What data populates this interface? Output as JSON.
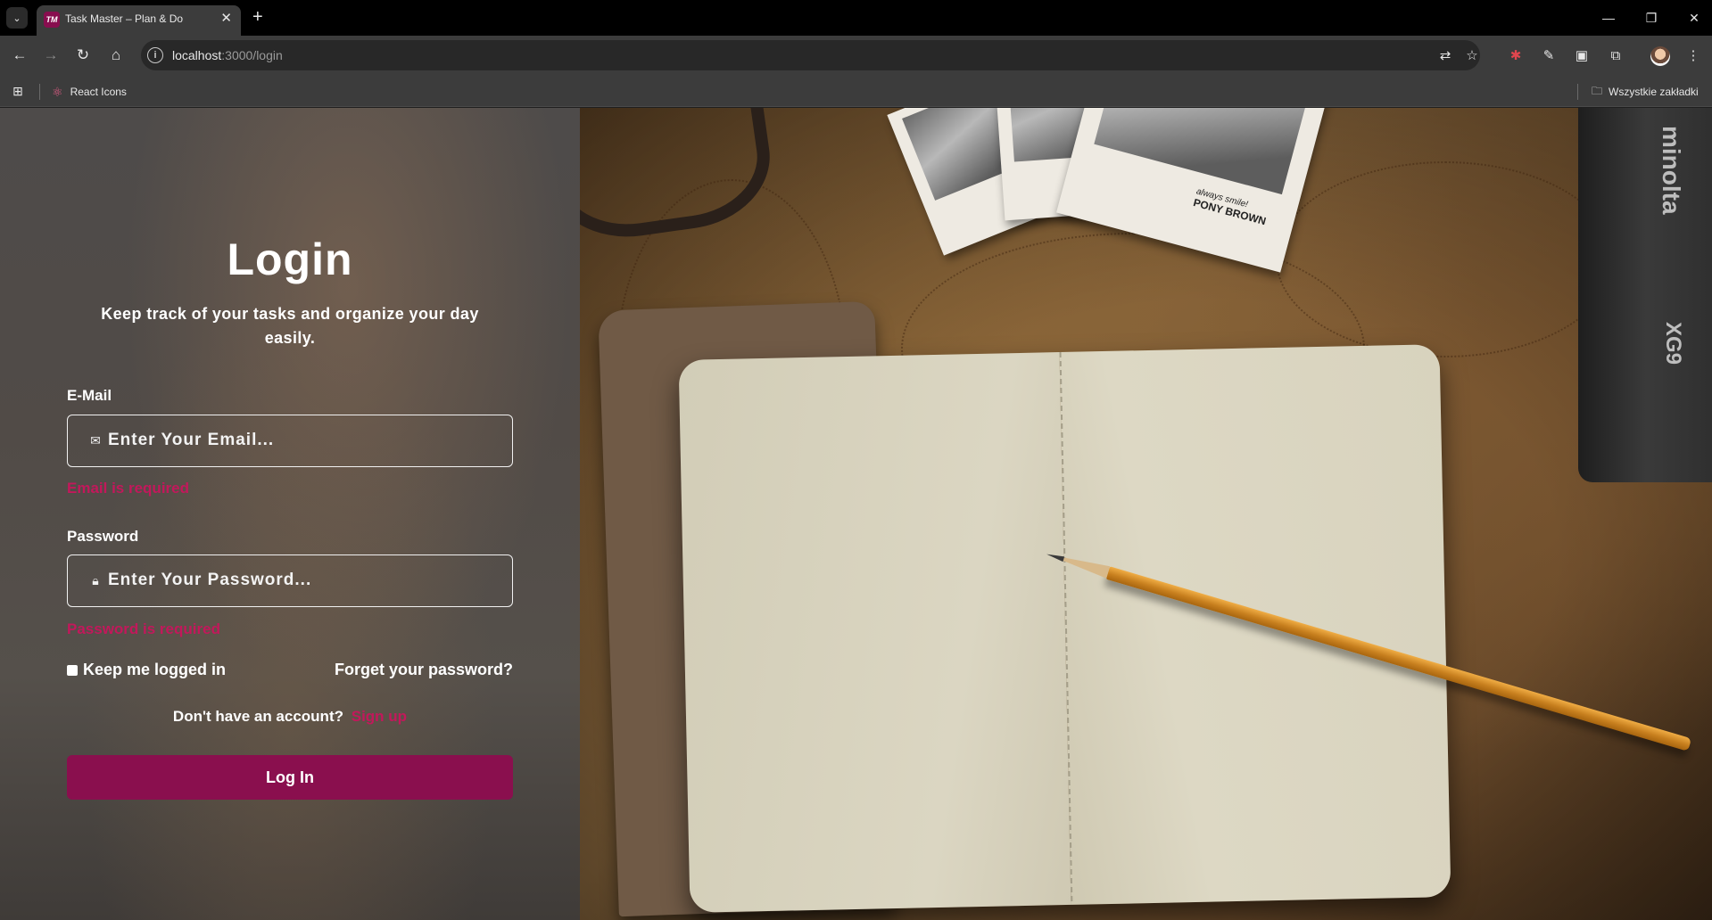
{
  "browser": {
    "tab": {
      "favicon_text": "TM",
      "title": "Task Master – Plan & Do"
    },
    "address": {
      "host": "localhost",
      "path": ":3000/login"
    },
    "bookmarks": [
      {
        "label": "React Icons"
      }
    ],
    "all_bookmarks_label": "Wszystkie zakładki"
  },
  "login": {
    "title": "Login",
    "subtitle": "Keep track of your tasks and organize your day easily.",
    "email": {
      "label": "E-Mail",
      "placeholder": "Enter Your Email...",
      "value": "",
      "error": "Email is required"
    },
    "password": {
      "label": "Password",
      "placeholder": "Enter Your Password...",
      "value": "",
      "error": "Password is required"
    },
    "remember_label": "Keep me logged in",
    "remember_checked": false,
    "forgot_label": "Forget your password?",
    "signup_prompt": "Don't have an account?",
    "signup_link": "Sign up",
    "submit_label": "Log In"
  },
  "photo": {
    "polaroid_caption_line1": "always smile!",
    "polaroid_caption_line2": "PONY BROWN",
    "camera_brand": "minolta",
    "camera_model": "XG9"
  },
  "colors": {
    "accent": "#8a0f4e",
    "error": "#c2185b",
    "chrome_bg": "#3c3c3c",
    "tabbar_bg": "#000000"
  },
  "icons": {
    "email_field": "envelope-icon",
    "password_field": "lock-icon"
  }
}
